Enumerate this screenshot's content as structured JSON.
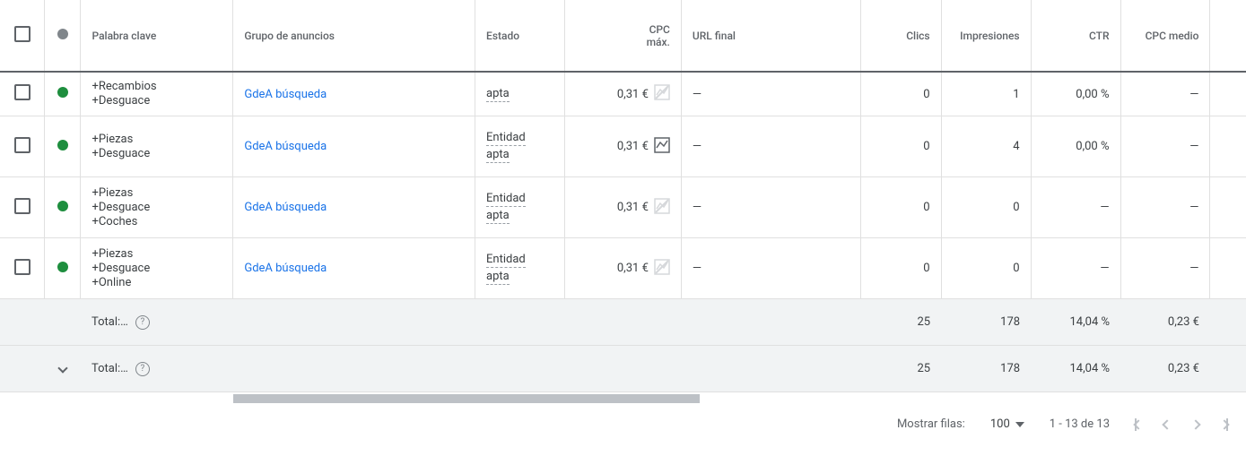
{
  "headers": {
    "keyword": "Palabra clave",
    "adgroup": "Grupo de anuncios",
    "status": "Estado",
    "cpc_max_l1": "CPC",
    "cpc_max_l2": "máx.",
    "final_url": "URL final",
    "clicks": "Clics",
    "impressions": "Impresiones",
    "ctr": "CTR",
    "cpc_avg": "CPC medio"
  },
  "rows": [
    {
      "keyword_lines": [
        "+Recambios",
        "+Desguace"
      ],
      "adgroup": "GdeA búsqueda",
      "status_lines": [
        "apta"
      ],
      "cpc": "0,31 €",
      "chart_active": false,
      "url": "—",
      "clicks": "0",
      "impressions": "1",
      "ctr": "0,00 %",
      "cpc_avg": "—",
      "partial_top": true
    },
    {
      "keyword_lines": [
        "+Piezas",
        "+Desguace"
      ],
      "adgroup": "GdeA búsqueda",
      "status_lines": [
        "Entidad",
        "apta"
      ],
      "cpc": "0,31 €",
      "chart_active": true,
      "url": "—",
      "clicks": "0",
      "impressions": "4",
      "ctr": "0,00 %",
      "cpc_avg": "—"
    },
    {
      "keyword_lines": [
        "+Piezas",
        "+Desguace",
        "+Coches"
      ],
      "adgroup": "GdeA búsqueda",
      "status_lines": [
        "Entidad",
        "apta"
      ],
      "cpc": "0,31 €",
      "chart_active": false,
      "url": "—",
      "clicks": "0",
      "impressions": "0",
      "ctr": "—",
      "cpc_avg": "—"
    },
    {
      "keyword_lines": [
        "+Piezas",
        "+Desguace",
        "+Online"
      ],
      "adgroup": "GdeA búsqueda",
      "status_lines": [
        "Entidad",
        "apta"
      ],
      "cpc": "0,31 €",
      "chart_active": false,
      "url": "—",
      "clicks": "0",
      "impressions": "0",
      "ctr": "—",
      "cpc_avg": "—"
    }
  ],
  "totals": [
    {
      "expandable": false,
      "label": "Total:…",
      "clicks": "25",
      "impressions": "178",
      "ctr": "14,04 %",
      "cpc_avg": "0,23 €"
    },
    {
      "expandable": true,
      "label": "Total:…",
      "clicks": "25",
      "impressions": "178",
      "ctr": "14,04 %",
      "cpc_avg": "0,23 €"
    }
  ],
  "footer": {
    "rows_label": "Mostrar filas:",
    "rows_value": "100",
    "range": "1 - 13 de 13"
  }
}
